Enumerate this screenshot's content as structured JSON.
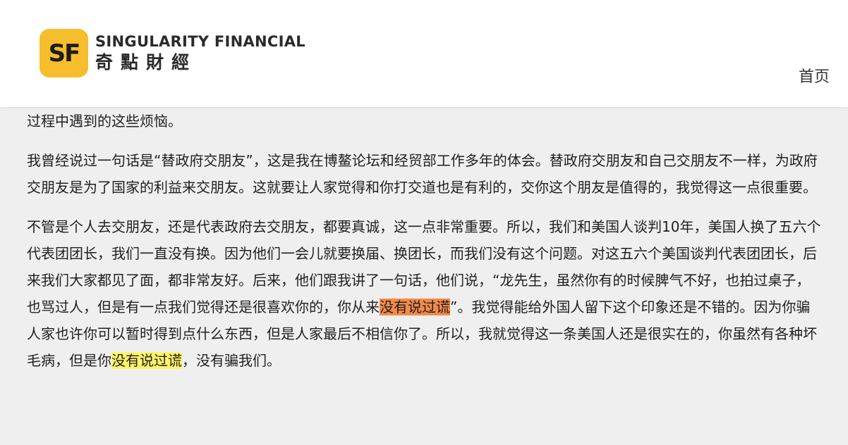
{
  "header": {
    "logo_mark": "SF",
    "brand_en": "SINGULARITY FINANCIAL",
    "brand_zh": "奇點財經",
    "nav_home": "首页"
  },
  "colors": {
    "logo_badge": "#f6bd2c",
    "highlight_orange": "#f48a4a",
    "highlight_yellow": "#fff36a",
    "page_background": "#efefef"
  },
  "article": {
    "para1": "过程中遇到的这些烦恼。",
    "para2": "我曾经说过一句话是“替政府交朋友”，这是我在博鳌论坛和经贸部工作多年的体会。替政府交朋友和自己交朋友不一样，为政府交朋友是为了国家的利益来交朋友。这就要让人家觉得和你打交道也是有利的，交你这个朋友是值得的，我觉得这一点很重要。",
    "para3_part1": "不管是个人去交朋友，还是代表政府去交朋友，都要真诚，这一点非常重要。所以，我们和美国人谈判10年，美国人换了五六个代表团团长，我们一直没有换。因为他们一会儿就要换届、换团长，而我们没有这个问题。对这五六个美国谈判代表团团长，后来我们大家都见了面，都非常友好。后来，他们跟我讲了一句话，他们说，“龙先生，虽然你有的时候脾气不好，也拍过桌子，也骂过人，但是有一点我们觉得还是很喜欢你的，你从来",
    "para3_hl1": "没有说过谎",
    "para3_part2": "”。我觉得能给外国人留下这个印象还是不错的。因为你骗人家也许你可以暂时得到点什么东西，但是人家最后不相信你了。所以，我就觉得这一条美国人还是很实在的，你虽然有各种坏毛病，但是你",
    "para3_hl2": "没有说过谎",
    "para3_part3": "，没有骗我们。"
  }
}
